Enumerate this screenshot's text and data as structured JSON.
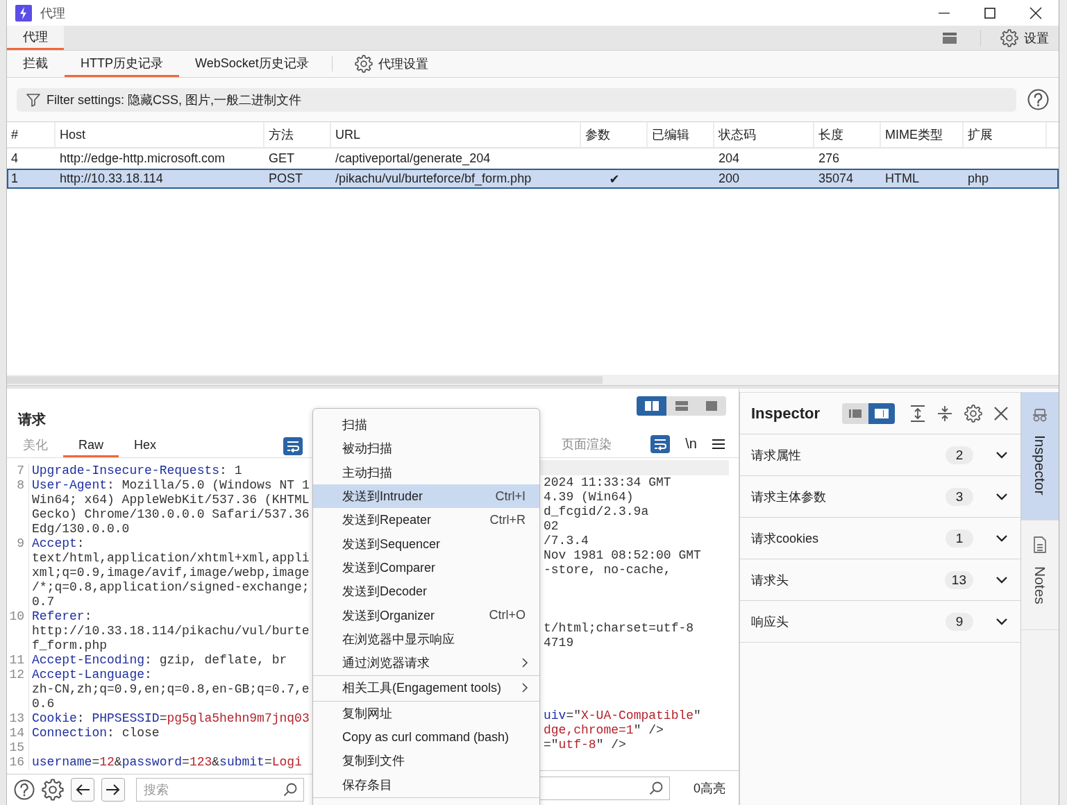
{
  "window": {
    "title": "代理"
  },
  "main_tabs": [
    {
      "label": "代理",
      "selected": true
    }
  ],
  "settings": {
    "label": "设置"
  },
  "sub_tabs": [
    {
      "label": "拦截",
      "selected": false
    },
    {
      "label": "HTTP历史记录",
      "selected": true
    },
    {
      "label": "WebSocket历史记录",
      "selected": false
    }
  ],
  "proxy_settings": {
    "label": "代理设置"
  },
  "filter": {
    "text": "Filter settings: 隐藏CSS, 图片,一般二进制文件"
  },
  "table": {
    "columns": [
      "#",
      "Host",
      "方法",
      "URL",
      "参数",
      "已编辑",
      "状态码",
      "长度",
      "MIME类型",
      "扩展"
    ],
    "rows": [
      {
        "selected": false,
        "cells": [
          "4",
          "http://edge-http.microsoft.com",
          "GET",
          "/captiveportal/generate_204",
          null,
          null,
          "204",
          "276",
          null,
          null
        ]
      },
      {
        "selected": true,
        "cells": [
          "1",
          "http://10.33.18.114",
          "POST",
          "/pikachu/vul/burteforce/bf_form.php",
          "✔",
          null,
          "200",
          "35074",
          "HTML",
          "php"
        ]
      }
    ]
  },
  "request": {
    "title": "请求",
    "tabs": [
      {
        "label": "美化",
        "selected": false,
        "disabled": true
      },
      {
        "label": "Raw",
        "selected": true,
        "disabled": false
      },
      {
        "label": "Hex",
        "selected": false,
        "disabled": false
      }
    ],
    "lines": [
      {
        "number": "7",
        "segments": [
          {
            "kind": "key",
            "text": "Upgrade-Insecure-Requests"
          },
          {
            "kind": "plain",
            "text": ": 1"
          }
        ]
      },
      {
        "number": "8",
        "segments": [
          {
            "kind": "key",
            "text": "User-Agent"
          },
          {
            "kind": "plain",
            "text": ": Mozilla/5.0 (Windows NT 1"
          }
        ]
      },
      {
        "segments": [
          {
            "kind": "plain",
            "text": "Win64; x64) AppleWebKit/537.36 (KHTML"
          }
        ]
      },
      {
        "segments": [
          {
            "kind": "plain",
            "text": "Gecko) Chrome/130.0.0.0 Safari/537.36"
          }
        ]
      },
      {
        "segments": [
          {
            "kind": "plain",
            "text": "Edg/130.0.0.0"
          }
        ]
      },
      {
        "number": "9",
        "segments": [
          {
            "kind": "key",
            "text": "Accept"
          },
          {
            "kind": "plain",
            "text": ":"
          }
        ]
      },
      {
        "segments": [
          {
            "kind": "plain",
            "text": "text/html,application/xhtml+xml,appli"
          }
        ]
      },
      {
        "segments": [
          {
            "kind": "plain",
            "text": "xml;q=0.9,image/avif,image/webp,image"
          }
        ]
      },
      {
        "segments": [
          {
            "kind": "plain",
            "text": "/*;q=0.8,application/signed-exchange;"
          }
        ]
      },
      {
        "segments": [
          {
            "kind": "plain",
            "text": "0.7"
          }
        ]
      },
      {
        "number": "10",
        "segments": [
          {
            "kind": "key",
            "text": "Referer"
          },
          {
            "kind": "plain",
            "text": ":"
          }
        ]
      },
      {
        "segments": [
          {
            "kind": "plain",
            "text": "http://10.33.18.114/pikachu/vul/burte"
          }
        ]
      },
      {
        "segments": [
          {
            "kind": "plain",
            "text": "f_form.php"
          }
        ]
      },
      {
        "number": "11",
        "segments": [
          {
            "kind": "key",
            "text": "Accept-Encoding"
          },
          {
            "kind": "plain",
            "text": ": gzip, deflate, br"
          }
        ]
      },
      {
        "number": "12",
        "segments": [
          {
            "kind": "key",
            "text": "Accept-Language"
          },
          {
            "kind": "plain",
            "text": ":"
          }
        ]
      },
      {
        "segments": [
          {
            "kind": "plain",
            "text": "zh-CN,zh;q=0.9,en;q=0.8,en-GB;q=0.7,e"
          }
        ]
      },
      {
        "segments": [
          {
            "kind": "plain",
            "text": "0.6"
          }
        ]
      },
      {
        "number": "13",
        "segments": [
          {
            "kind": "key",
            "text": "Cookie"
          },
          {
            "kind": "plain",
            "text": ": "
          },
          {
            "kind": "key",
            "text": "PHPSESSID"
          },
          {
            "kind": "plain",
            "text": "="
          },
          {
            "kind": "value",
            "text": "pg5gla5hehn9m7jnq03"
          }
        ]
      },
      {
        "number": "14",
        "segments": [
          {
            "kind": "key",
            "text": "Connection"
          },
          {
            "kind": "plain",
            "text": ": close"
          }
        ]
      },
      {
        "number": "15"
      },
      {
        "number": "16",
        "segments": [
          {
            "kind": "key",
            "text": "username"
          },
          {
            "kind": "plain",
            "text": "="
          },
          {
            "kind": "value",
            "text": "12"
          },
          {
            "kind": "plain",
            "text": "&"
          },
          {
            "kind": "key",
            "text": "password"
          },
          {
            "kind": "plain",
            "text": "="
          },
          {
            "kind": "value",
            "text": "123"
          },
          {
            "kind": "plain",
            "text": "&"
          },
          {
            "kind": "key",
            "text": "submit"
          },
          {
            "kind": "plain",
            "text": "="
          },
          {
            "kind": "value",
            "text": "Logi"
          }
        ]
      }
    ],
    "search": {
      "placeholder": "搜索"
    }
  },
  "response": {
    "layout_modes": [
      {
        "kind": "columns",
        "selected": true
      },
      {
        "kind": "rows",
        "selected": false
      },
      {
        "kind": "single",
        "selected": false
      }
    ],
    "tabs": [
      {
        "label": "页面渲染",
        "selected": false,
        "disabled": true
      }
    ],
    "newline_toggle": "\\n",
    "lines": [
      {
        "segments": [
          {
            "kind": "plain",
            "text": "2024 11:33:34 GMT"
          }
        ]
      },
      {
        "segments": [
          {
            "kind": "plain",
            "text": "4.39 (Win64)"
          }
        ]
      },
      {
        "segments": [
          {
            "kind": "plain",
            "text": "d_fcgid/2.3.9a"
          }
        ]
      },
      {
        "segments": [
          {
            "kind": "plain",
            "text": "02"
          }
        ]
      },
      {
        "segments": [
          {
            "kind": "plain",
            "text": "/7.3.4"
          }
        ]
      },
      {
        "segments": [
          {
            "kind": "plain",
            "text": "Nov 1981 08:52:00 GMT"
          }
        ]
      },
      {
        "segments": [
          {
            "kind": "plain",
            "text": "-store, no-cache,"
          }
        ]
      },
      {
        "segments": [
          {
            "kind": "plain",
            "text": "t/html;charset=utf-8"
          }
        ]
      },
      {
        "segments": [
          {
            "kind": "plain",
            "text": "4719"
          }
        ]
      },
      {
        "segments": [
          {
            "kind": "key",
            "text": "uiv"
          },
          {
            "kind": "plain",
            "text": "=\""
          },
          {
            "kind": "value",
            "text": "X-UA-Compatible"
          },
          {
            "kind": "plain",
            "text": "\""
          }
        ]
      },
      {
        "segments": [
          {
            "kind": "value",
            "text": "dge,chrome=1"
          },
          {
            "kind": "plain",
            "text": "\" />"
          }
        ]
      },
      {
        "segments": [
          {
            "kind": "plain",
            "text": "=\""
          },
          {
            "kind": "value",
            "text": "utf-8"
          },
          {
            "kind": "plain",
            "text": "\" />"
          }
        ]
      }
    ],
    "highlights": "0高亮"
  },
  "context_menu": {
    "sections": [
      [
        {
          "label": "扫描",
          "selected": false,
          "submenu": false
        },
        {
          "label": "被动扫描",
          "selected": false,
          "submenu": false
        },
        {
          "label": "主动扫描",
          "selected": false,
          "submenu": false
        },
        {
          "label": "发送到Intruder",
          "shortcut": "Ctrl+I",
          "selected": true,
          "submenu": false
        },
        {
          "label": "发送到Repeater",
          "shortcut": "Ctrl+R",
          "selected": false,
          "submenu": false
        },
        {
          "label": "发送到Sequencer",
          "selected": false,
          "submenu": false
        },
        {
          "label": "发送到Comparer",
          "selected": false,
          "submenu": false
        },
        {
          "label": "发送到Decoder",
          "selected": false,
          "submenu": false
        },
        {
          "label": "发送到Organizer",
          "shortcut": "Ctrl+O",
          "selected": false,
          "submenu": false
        },
        {
          "label": "在浏览器中显示响应",
          "selected": false,
          "submenu": false
        },
        {
          "label": "通过浏览器请求",
          "selected": false,
          "submenu": true
        }
      ],
      [
        {
          "label": "相关工具(Engagement tools)",
          "selected": false,
          "submenu": true
        }
      ],
      [
        {
          "label": "复制网址",
          "selected": false,
          "submenu": false
        },
        {
          "label": "Copy as curl command (bash)",
          "selected": false,
          "submenu": false
        },
        {
          "label": "复制到文件",
          "selected": false,
          "submenu": false
        },
        {
          "label": "保存条目",
          "selected": false,
          "submenu": false
        }
      ]
    ]
  },
  "inspector": {
    "title": "Inspector",
    "layout_modes": [
      {
        "kind": "panel-left",
        "selected": false
      },
      {
        "kind": "panel-right",
        "selected": true
      }
    ],
    "sections": [
      {
        "label": "请求属性",
        "count": "2",
        "expanded": false
      },
      {
        "label": "请求主体参数",
        "count": "3",
        "expanded": false
      },
      {
        "label": "请求cookies",
        "count": "1",
        "expanded": false
      },
      {
        "label": "请求头",
        "count": "13",
        "expanded": false
      },
      {
        "label": "响应头",
        "count": "9",
        "expanded": false
      }
    ]
  },
  "side_tabs": [
    {
      "kind": "inspector",
      "label": "Inspector",
      "selected": true
    },
    {
      "kind": "notes",
      "label": "Notes",
      "selected": false
    }
  ]
}
